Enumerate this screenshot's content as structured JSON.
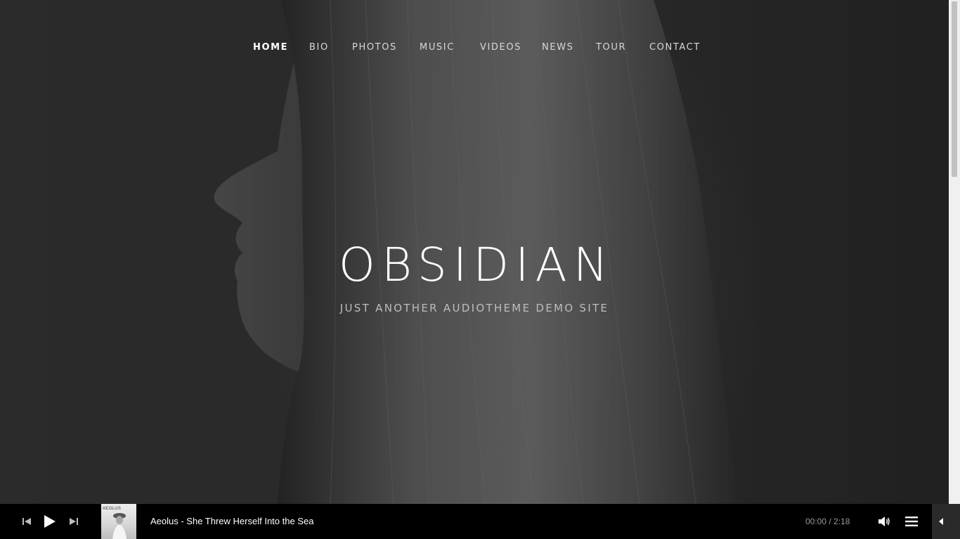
{
  "nav": {
    "items": [
      {
        "label": "HOME",
        "active": true
      },
      {
        "label": "BIO"
      },
      {
        "label": "PHOTOS"
      },
      {
        "label": "MUSIC"
      },
      {
        "label": "VIDEOS"
      },
      {
        "label": "NEWS"
      },
      {
        "label": "TOUR"
      },
      {
        "label": "CONTACT"
      }
    ]
  },
  "hero": {
    "title": "OBSIDIAN",
    "tagline": "JUST ANOTHER AUDIOTHEME DEMO SITE"
  },
  "player": {
    "track": "Aeolus - She Threw Herself Into the Sea",
    "album_art_text": "AEOLUS",
    "current_time": "00:00",
    "separator": " / ",
    "duration": "2:18",
    "icons": [
      "previous-icon",
      "play-icon",
      "next-icon",
      "volume-icon",
      "playlist-icon",
      "chevron-left-icon"
    ]
  }
}
